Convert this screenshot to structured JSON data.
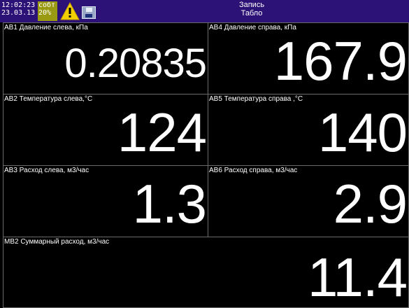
{
  "header": {
    "time": "12:02:23",
    "date": "23.03.13",
    "status_label": "собт",
    "status_percent": "20%",
    "title_line1": "Запись",
    "title_line2": "Табло",
    "warning_icon": "warning-icon",
    "save_icon": "floppy-disk-icon",
    "colors": {
      "header_bg": "#2c1176",
      "status_bg": "#9a9a12",
      "warning_fill": "#f0d000"
    }
  },
  "panels": [
    {
      "label": "АВ1 Давление слева, кПа",
      "value": "0.20835"
    },
    {
      "label": "АВ4 Давление справа, кПа",
      "value": "167.9"
    },
    {
      "label": "АВ2 Температура слева,°С",
      "value": "124"
    },
    {
      "label": "АВ5 Температура справа ,°С",
      "value": "140"
    },
    {
      "label": "АВ3 Расход слева, м3/час",
      "value": "1.3"
    },
    {
      "label": "АВ6 Расход справа, м3/час",
      "value": "2.9"
    },
    {
      "label": "МВ2 Суммарный расход, м3/час",
      "value": "11.4"
    }
  ]
}
